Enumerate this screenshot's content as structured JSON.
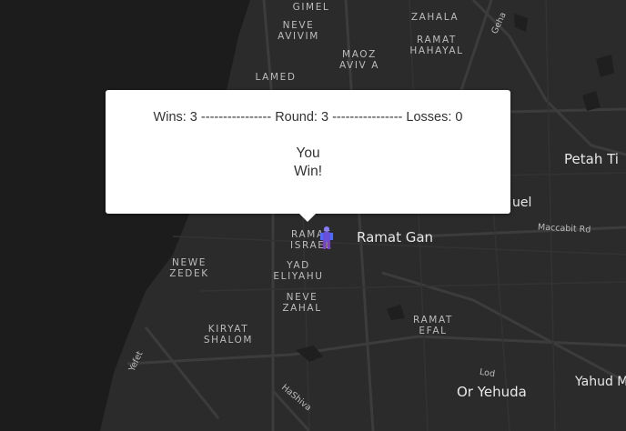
{
  "popup": {
    "wins": "Wins: 3",
    "round": "Round: 3",
    "losses": "Losses: 0",
    "separator": "----------------",
    "result_line1": "You",
    "result_line2": "Win!"
  },
  "map": {
    "neighborhoods": {
      "gimel": "GIMEL",
      "neve_avivim": "NEVE\nAVIVIM",
      "zahala": "ZAHALA",
      "ramat_hahayal": "RAMAT\nHAHAYAL",
      "maoz_aviv": "MAOZ\nAVIV A",
      "lamed": "LAMED",
      "ramat_israel": "RAMAT\nISRAEL",
      "newe_zedek": "NEWE\nZEDEK",
      "yad_eliyahu": "YAD\nELIYAHU",
      "neve_zahal": "NEVE\nZAHAL",
      "kiryat_shalom": "KIRYAT\nSHALOM",
      "ramat_efal": "RAMAT\nEFAL"
    },
    "cities": {
      "ramat_gan": "Ramat Gan",
      "petah_tikva": "Petah Ti",
      "or_yehuda": "Or Yehuda",
      "yahud": "Yahud M",
      "bnei_brak_partial": "uel"
    },
    "roads": {
      "geha": "Geha",
      "maccabit": "Maccabit Rd",
      "yefet": "Yefet",
      "hashiva": "HaShiva",
      "lod": "Lod"
    }
  },
  "colors": {
    "sea": "#1c1c1c",
    "land": "#2b2b2b",
    "road": "#3c3c3c",
    "popup_bg": "#ffffff",
    "marker": "#6a4fd8"
  }
}
